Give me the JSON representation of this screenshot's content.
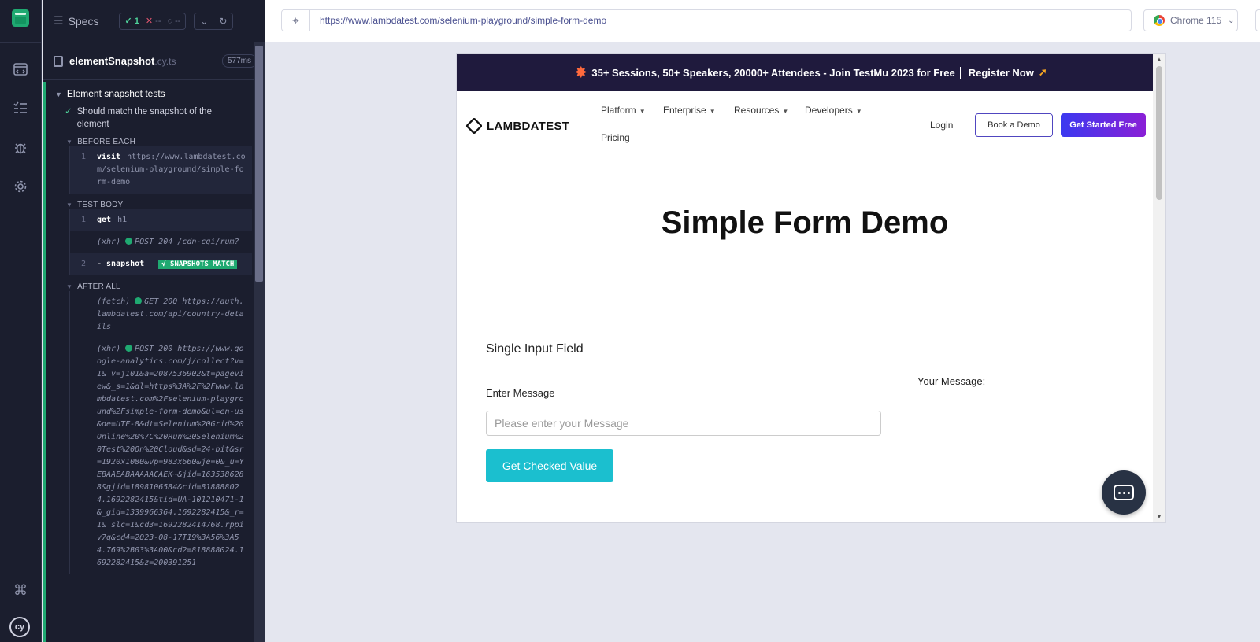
{
  "reporter": {
    "specs_label": "Specs",
    "stats": {
      "passed": "1",
      "failed": "--",
      "pending": "--"
    },
    "spec_file": {
      "name": "elementSnapshot",
      "ext": ".cy.ts",
      "duration": "577ms"
    },
    "suite_title": "Element snapshot tests",
    "test_title": "Should match the snapshot of the element",
    "hooks": {
      "before_each": "BEFORE EACH",
      "test_body": "TEST BODY",
      "after_all": "AFTER ALL"
    },
    "commands": {
      "visit": {
        "num": "1",
        "name": "visit",
        "arg": "https://www.lambdatest.com/selenium-playground/simple-form-demo"
      },
      "get": {
        "num": "1",
        "name": "get",
        "arg": "h1"
      },
      "xhr_rum": {
        "prefix": "(xhr)",
        "text": "POST 204 /cdn-cgi/rum?"
      },
      "snapshot": {
        "num": "2",
        "name": "- snapshot",
        "badge": "√ SNAPSHOTS MATCH"
      },
      "fetch": {
        "prefix": "(fetch)",
        "text": "GET 200 https://auth.lambdatest.com/api/country-details"
      },
      "xhr_ga": {
        "prefix": "(xhr)",
        "text": "POST 200 https://www.google-analytics.com/j/collect?v=1&_v=j101&a=2087536902&t=pageview&_s=1&dl=https%3A%2F%2Fwww.lambdatest.com%2Fselenium-playground%2Fsimple-form-demo&ul=en-us&de=UTF-8&dt=Selenium%20Grid%20Online%20%7C%20Run%20Selenium%20Test%20On%20Cloud&sd=24-bit&sr=1920x1080&vp=983x660&je=0&_u=YEBAAEABAAAAACAEK~&jid=1635386288&gjid=1898106584&cid=818888024.1692282415&tid=UA-101210471-1&_gid=1339966364.1692282415&_r=1&_slc=1&cd3=1692282414768.rppiv7g&cd4=2023-08-17T19%3A56%3A54.769%2B03%3A00&cd2=818888024.1692282415&z=200391251"
      }
    }
  },
  "url_bar": {
    "url": "https://www.lambdatest.com/selenium-playground/simple-form-demo",
    "browser": "Chrome 115"
  },
  "aut": {
    "promo": {
      "text": "35+ Sessions, 50+ Speakers, 20000+ Attendees - Join TestMu 2023 for Free",
      "cta": "Register Now"
    },
    "brand": "LAMBDATEST",
    "menu": [
      "Platform",
      "Enterprise",
      "Resources",
      "Developers",
      "Pricing"
    ],
    "login": "Login",
    "book_demo": "Book a Demo",
    "get_started": "Get Started Free",
    "page_title": "Simple Form Demo",
    "section_label": "Single Input Field",
    "input_label": "Enter Message",
    "input_placeholder": "Please enter your Message",
    "message_label": "Your Message:",
    "button_label": "Get Checked Value"
  },
  "colors": {
    "pass": "#1fa971",
    "accent": "#1bbfcf",
    "promo_bg": "#1f1a3d",
    "rail_bg": "#1b1e2e"
  },
  "icons": [
    "cypress-logo-icon",
    "browser-icon",
    "runs-list-icon",
    "debug-icon",
    "settings-icon",
    "keyboard-shortcuts-icon",
    "cy-icon",
    "crosshair-icon",
    "chrome-icon",
    "chat-icon"
  ]
}
